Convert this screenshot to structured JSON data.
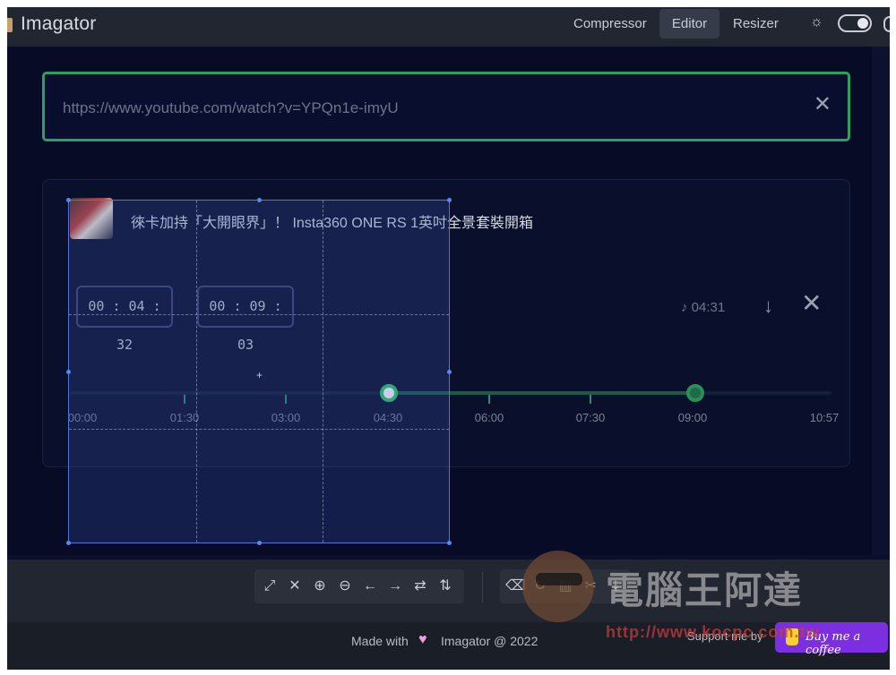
{
  "app": {
    "title": "Imagator"
  },
  "nav": {
    "items": [
      "Compressor",
      "Editor",
      "Resizer"
    ],
    "active": "Editor"
  },
  "theme_toggle": {
    "icon": "sun-icon",
    "state": "on"
  },
  "url_input": {
    "value": "https://www.youtube.com/watch?v=YPQn1e-imyU",
    "clear_icon": "close-icon"
  },
  "video": {
    "title": "徠卡加持「大開眼界」！ Insta360 ONE RS 1英吋全景套裝開箱",
    "start_time": "00 : 04 : 32",
    "end_time": "00 : 09 : 03",
    "duration": "♪ 04:31",
    "download_icon": "arrow-down-icon",
    "remove_icon": "close-icon",
    "timeline_ticks": [
      "00:00",
      "01:30",
      "03:00",
      "04:30",
      "06:00",
      "07:30",
      "09:00",
      "10:57"
    ]
  },
  "toolbar": {
    "group1_icons": [
      "expand-icon",
      "close-icon",
      "zoom-in-icon",
      "zoom-out-icon",
      "arrow-left-icon",
      "arrow-right-icon",
      "swap-horizontal-icon",
      "swap-vertical-icon"
    ],
    "group2_icons": [
      "backspace-icon",
      "rotate-icon",
      "trash-icon",
      "scissors-icon",
      "download-icon"
    ]
  },
  "footer": {
    "made_with": "Made with",
    "credit": "Imagator @ 2022",
    "support": "Support me by",
    "coffee_label": "Buy me a coffee"
  },
  "watermark": {
    "text": "電腦王阿達",
    "url": "http://www.kocpc.com.tw"
  }
}
